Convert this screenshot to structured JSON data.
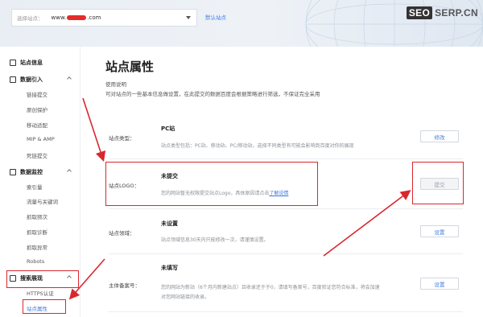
{
  "header": {
    "site_select_label": "选择站点：",
    "site_prefix": "www.",
    "site_suffix": ".com",
    "default_site_link": "默认站点",
    "brand_seo": "SEO",
    "brand_domain": "SERP.CN"
  },
  "sidebar": {
    "sections": [
      {
        "label": "站点信息",
        "icon": "home-icon"
      },
      {
        "label": "数据引入",
        "icon": "data-import-icon",
        "items": [
          "链接提交",
          "原创保护",
          "移动适配",
          "MIP & AMP",
          "死链提交"
        ]
      },
      {
        "label": "数据监控",
        "icon": "chart-icon",
        "items": [
          "索引量",
          "流量与关键词",
          "抓取频次",
          "抓取诊断",
          "抓取异常",
          "Robots"
        ]
      },
      {
        "label": "搜索展现",
        "icon": "search-display-icon",
        "items": [
          "HTTPS认证",
          "站点属性"
        ]
      }
    ],
    "active_item": "站点属性"
  },
  "main": {
    "title": "站点属性",
    "usage_title": "使用说明",
    "usage_desc": "可对站点的一些基本信息做设置，在此提交的数据百度会根据策略进行筛选，不保证完全采用",
    "rows": [
      {
        "label": "站点类型：",
        "value": "PC站",
        "desc": "站点类型包括：PC站、移动站、PC/移动站，选择不同类型有可能会影响到百度对你的展现",
        "button": "修改"
      },
      {
        "label": "站点LOGO：",
        "value": "未提交",
        "desc_pre": "您的网站暂无权限提交站点Logo，具体原因请点击",
        "desc_link": "了解说情",
        "button": "提交"
      },
      {
        "label": "站点领域：",
        "value": "未设置",
        "desc": "站点领域信息30天内只能修改一次，请谨慎设置。",
        "button": "设置"
      },
      {
        "label": "主体备案号：",
        "value": "未填写",
        "desc": "您的网站为新站（6个月内新建站点）且收录还于于0，请填写备案号，百度验证您符合标准，将会加速",
        "desc2": "对您网站链接的收录。",
        "button": "设置"
      }
    ]
  },
  "colors": {
    "accent": "#3f7ce0",
    "annotation_red": "#d9272e"
  }
}
